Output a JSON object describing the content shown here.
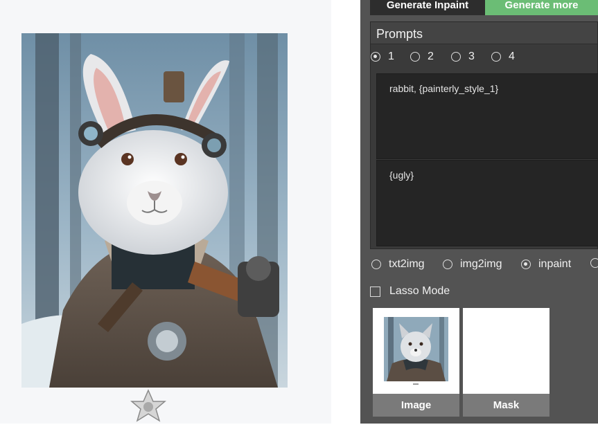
{
  "toolbar": {
    "generate_inpaint_label": "Generate Inpaint",
    "generate_more_label": "Generate more",
    "generate_more_color": "#6bbd75"
  },
  "prompts": {
    "title": "Prompts",
    "tabs": [
      {
        "label": "1",
        "selected": true
      },
      {
        "label": "2",
        "selected": false
      },
      {
        "label": "3",
        "selected": false
      },
      {
        "label": "4",
        "selected": false
      }
    ],
    "positive": "rabbit, {painterly_style_1}",
    "negative": "{ugly}"
  },
  "modes": {
    "options": [
      {
        "label": "txt2img",
        "selected": false
      },
      {
        "label": "img2img",
        "selected": false
      },
      {
        "label": "inpaint",
        "selected": true
      }
    ]
  },
  "lasso": {
    "label": "Lasso Mode",
    "checked": false
  },
  "thumbnails": {
    "image_label": "Image",
    "mask_label": "Mask"
  },
  "canvas": {
    "subject": "white rabbit with steampunk goggles in a brown jacket, snowy forest",
    "emblem_icon": "star-emblem-icon"
  },
  "colors": {
    "panel_bg": "#535353",
    "accent_green": "#6bbd75",
    "textarea_bg": "#252525"
  }
}
